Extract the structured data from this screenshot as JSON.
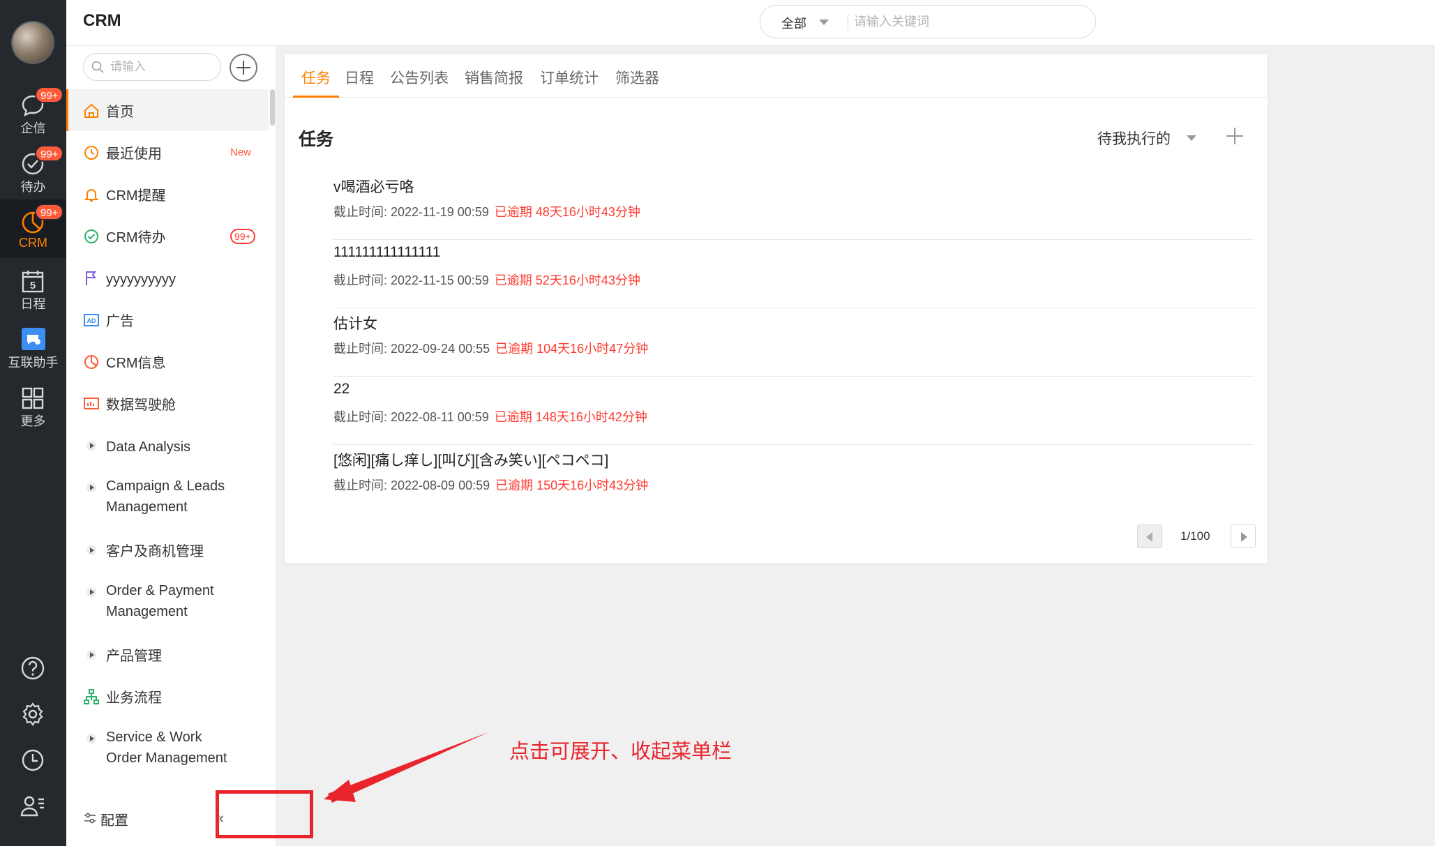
{
  "rail": {
    "items": [
      {
        "label": "企信",
        "badge": "99+",
        "icon": "chat-bubble-icon"
      },
      {
        "label": "待办",
        "badge": "99+",
        "icon": "check-circle-icon"
      },
      {
        "label": "CRM",
        "badge": "99+",
        "icon": "crm-chart-icon",
        "active": true
      },
      {
        "label": "日程",
        "icon": "calendar-icon",
        "day": "5"
      },
      {
        "label": "互联助手",
        "icon": "link-assistant-icon"
      },
      {
        "label": "更多",
        "icon": "grid-apps-icon"
      }
    ],
    "bottom_icons": [
      "help-icon",
      "settings-icon",
      "history-clock-icon",
      "contacts-icon"
    ]
  },
  "header": {
    "title": "CRM",
    "search_scope": "全部",
    "search_placeholder": "请输入关键词"
  },
  "menu": {
    "search_placeholder": "请输入",
    "items": [
      {
        "label": "首页",
        "icon": "home-icon",
        "active": true
      },
      {
        "label": "最近使用",
        "icon": "clock-icon",
        "tag": "New"
      },
      {
        "label": "CRM提醒",
        "icon": "bell-icon"
      },
      {
        "label": "CRM待办",
        "icon": "check-circle-icon",
        "badge": "99+"
      },
      {
        "label": "yyyyyyyyyy",
        "icon": "flag-icon"
      },
      {
        "label": "广告",
        "icon": "ad-icon"
      },
      {
        "label": "CRM信息",
        "icon": "pie-icon"
      },
      {
        "label": "数据驾驶舱",
        "icon": "dashboard-icon"
      },
      {
        "label": "Data Analysis",
        "icon": "expand-triangle-icon"
      },
      {
        "label": "Campaign & Leads\nManagement",
        "icon": "expand-triangle-icon"
      },
      {
        "label": "客户及商机管理",
        "icon": "expand-triangle-icon"
      },
      {
        "label": "Order & Payment\nManagement",
        "icon": "expand-triangle-icon"
      },
      {
        "label": "产品管理",
        "icon": "expand-triangle-icon"
      },
      {
        "label": "业务流程",
        "icon": "org-tree-icon"
      },
      {
        "label": "Service & Work\nOrder Management",
        "icon": "expand-triangle-icon"
      }
    ],
    "config_label": "配置",
    "collapse_symbol": "«"
  },
  "main": {
    "tabs": [
      "任务",
      "日程",
      "公告列表",
      "销售简报",
      "订单统计",
      "筛选器"
    ],
    "active_tab": 0,
    "section_title": "任务",
    "filter_label": "待我执行的",
    "tasks": [
      {
        "title": "v喝酒必亏咯",
        "deadline_label": "截止时间: 2022-11-19 00:59",
        "overdue": "已逾期 48天16小时43分钟"
      },
      {
        "title": "111111111111111",
        "deadline_label": "截止时间: 2022-11-15 00:59",
        "overdue": "已逾期 52天16小时43分钟"
      },
      {
        "title": "估计女",
        "deadline_label": "截止时间: 2022-09-24 00:55",
        "overdue": "已逾期 104天16小时47分钟"
      },
      {
        "title": "22",
        "deadline_label": "截止时间: 2022-08-11 00:59",
        "overdue": "已逾期 148天16小时42分钟"
      },
      {
        "title": "[悠闲][痛し痒し][叫び][含み笑い][ペコペコ]",
        "deadline_label": "截止时间: 2022-08-09 00:59",
        "overdue": "已逾期 150天16小时43分钟"
      }
    ],
    "pager_text": "1/100"
  },
  "annotation": {
    "text": "点击可展开、收起菜单栏",
    "color": "#e8242c"
  },
  "colors": {
    "accent": "#ff8000",
    "rail_bg": "#25292e",
    "badge": "#ff5b3b",
    "overdue": "#ff3b30"
  }
}
